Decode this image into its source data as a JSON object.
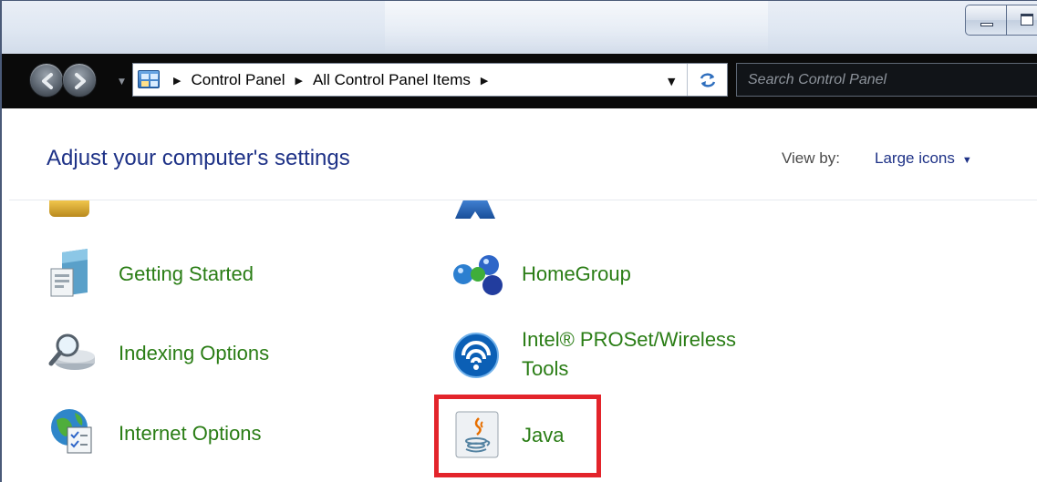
{
  "window": {
    "minimize_icon": "minimize-icon",
    "maximize_icon": "maximize-icon"
  },
  "navigation": {
    "back_icon": "back-arrow-icon",
    "forward_icon": "forward-arrow-icon",
    "breadcrumbs": [
      "Control Panel",
      "All Control Panel Items"
    ],
    "refresh_icon": "refresh-icon",
    "search_placeholder": "Search Control Panel"
  },
  "header": {
    "title": "Adjust your computer's settings",
    "view_by_label": "View by:",
    "view_by_value": "Large icons"
  },
  "items": {
    "getting_started": "Getting Started",
    "homegroup": "HomeGroup",
    "indexing_options": "Indexing Options",
    "intel_proset_line1": "Intel® PROSet/Wireless",
    "intel_proset_line2": "Tools",
    "internet_options": "Internet Options",
    "java": "Java"
  },
  "colors": {
    "link_green": "#2a7d15",
    "heading_blue": "#1e3287",
    "highlight_red": "#e3242b"
  }
}
